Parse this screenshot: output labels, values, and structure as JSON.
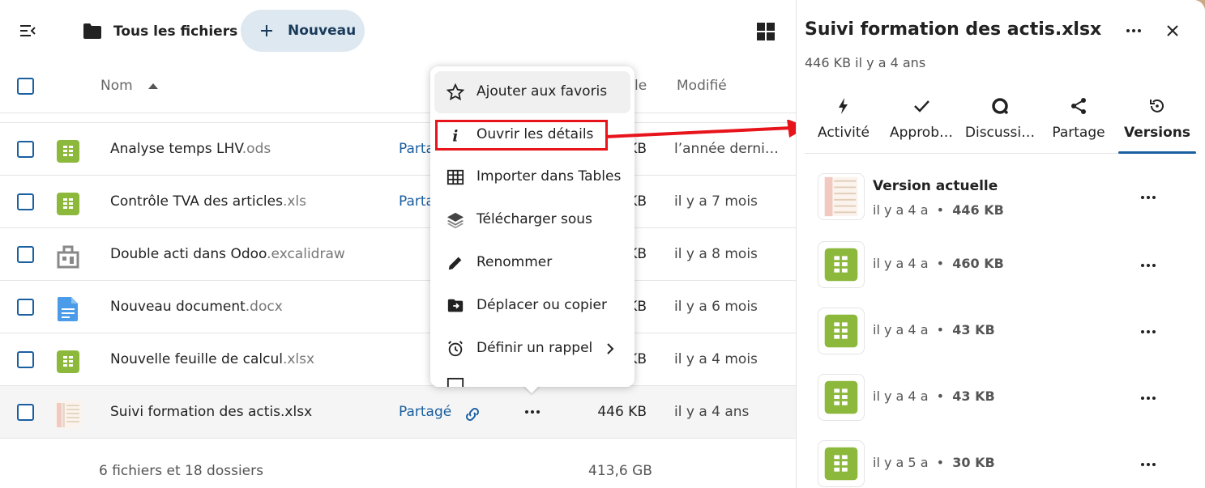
{
  "header": {
    "breadcrumb": "Tous les fichiers",
    "new_label": "Nouveau"
  },
  "table": {
    "col_name": "Nom",
    "col_size_partial": "le",
    "col_modified": "Modifié",
    "rows": [
      {
        "name": "Analyse temps LHV",
        "ext": ".ods",
        "share": "Partag",
        "size": "KB",
        "modified": "l’année derni…",
        "icon": "spreadsheet-icon"
      },
      {
        "name": "Contrôle TVA des articles",
        "ext": ".xls",
        "share": "Partag",
        "size": "KB",
        "modified": "il y a 7 mois",
        "icon": "spreadsheet-icon"
      },
      {
        "name": "Double acti dans Odoo",
        "ext": ".excalidraw",
        "share": "",
        "size": "KB",
        "modified": "il y a 8 mois",
        "icon": "excalidraw-file-icon"
      },
      {
        "name": "Nouveau document",
        "ext": ".docx",
        "share": "",
        "size": "KB",
        "modified": "il y a 6 mois",
        "icon": "document-icon"
      },
      {
        "name": "Nouvelle feuille de calcul",
        "ext": ".xlsx",
        "share": "",
        "size": "KB",
        "modified": "il y a 4 mois",
        "icon": "spreadsheet-icon"
      },
      {
        "name": "Suivi formation des actis",
        "ext": ".xlsx",
        "share": "Partagé",
        "size": "446 KB",
        "modified": "il y a 4 ans",
        "icon": "spreadsheet-preview-icon"
      }
    ],
    "footer_summary": "6 fichiers et 18 dossiers",
    "footer_total": "413,6 GB"
  },
  "context_menu": {
    "items": [
      {
        "label": "Ajouter aux favoris",
        "icon": "star-icon"
      },
      {
        "label": "Ouvrir les détails",
        "icon": "info-icon"
      },
      {
        "label": "Importer dans Tables",
        "icon": "table-icon"
      },
      {
        "label": "Télécharger sous",
        "icon": "layers-icon"
      },
      {
        "label": "Renommer",
        "icon": "pencil-icon"
      },
      {
        "label": "Déplacer ou copier",
        "icon": "folder-move-icon"
      },
      {
        "label": "Définir un rappel",
        "icon": "alarm-icon"
      }
    ]
  },
  "sidebar": {
    "title": "Suivi formation des actis.xlsx",
    "subtitle": "446 KB il y a 4 ans",
    "tabs": [
      {
        "label": "Activité",
        "icon": "lightning-icon"
      },
      {
        "label": "Approb…",
        "icon": "check-icon"
      },
      {
        "label": "Discussi…",
        "icon": "talk-icon"
      },
      {
        "label": "Partage",
        "icon": "share-icon"
      },
      {
        "label": "Versions",
        "icon": "history-icon"
      }
    ],
    "versions": [
      {
        "name": "Version actuelle",
        "age": "il y a 4 a",
        "size": "446 KB"
      },
      {
        "name": "",
        "age": "il y a 4 a",
        "size": "460 KB"
      },
      {
        "name": "",
        "age": "il y a 4 a",
        "size": "43 KB"
      },
      {
        "name": "",
        "age": "il y a 4 a",
        "size": "43 KB"
      },
      {
        "name": "",
        "age": "il y a 5 a",
        "size": "30 KB"
      }
    ]
  },
  "colors": {
    "primary": "#1a5fa0",
    "spreadsheet_green": "#8cb83b",
    "document_blue": "#4a9be8",
    "highlight_red": "#e8141b"
  }
}
